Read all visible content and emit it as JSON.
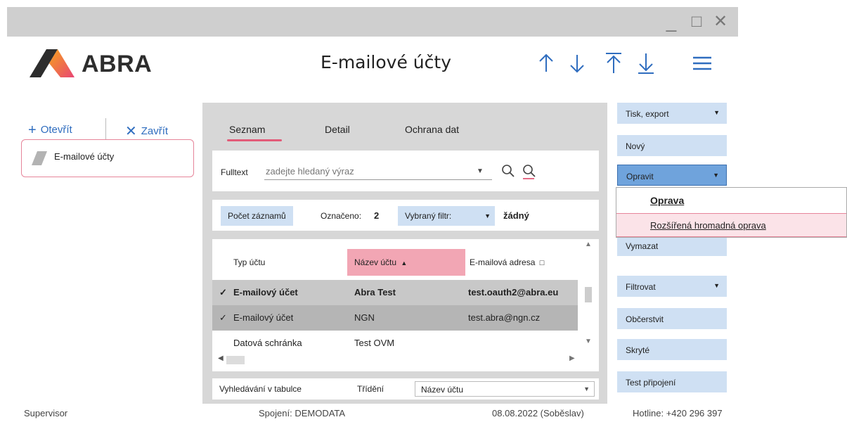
{
  "window": {
    "controls": {
      "minimize": "_",
      "maximize": "□",
      "close": "✕"
    }
  },
  "header": {
    "logo_text": "ABRA",
    "title": "E-mailové účty",
    "nav_icons": [
      "arrow-up-icon",
      "arrow-down-icon",
      "arrow-to-top-icon",
      "arrow-to-bottom-icon",
      "hamburger-menu-icon"
    ]
  },
  "left_panel": {
    "open_label": "Otevřít",
    "close_label": "Zavřít",
    "doc_item_label": "E-mailové účty"
  },
  "tabs": [
    {
      "label": "Seznam",
      "active": true
    },
    {
      "label": "Detail",
      "active": false
    },
    {
      "label": "Ochrana dat",
      "active": false
    }
  ],
  "fulltext": {
    "label": "Fulltext",
    "placeholder": "zadejte hledaný výraz"
  },
  "stats": {
    "count_button": "Počet záznamů",
    "marked_label": "Označeno:",
    "marked_value": "2",
    "filter_label": "Vybraný filtr:",
    "filter_value": "žádný"
  },
  "table": {
    "columns": [
      "Typ účtu",
      "Název účtu",
      "E-mailová adresa"
    ],
    "sort_indicator": "▲",
    "rows": [
      {
        "check": "✓",
        "type": "E-mailový účet",
        "name": "Abra Test",
        "email": "test.oauth2@abra.eu"
      },
      {
        "check": "✓",
        "type": "E-mailový účet",
        "name": "NGN",
        "email": "test.abra@ngn.cz"
      },
      {
        "check": "",
        "type": "Datová schránka",
        "name": "Test OVM",
        "email": ""
      }
    ]
  },
  "search_bar": {
    "label": "Vyhledávání v tabulce",
    "sort_label": "Třídění",
    "sort_value": "Název účtu"
  },
  "actions": {
    "print_export": "Tisk, export",
    "new": "Nový",
    "edit": "Opravit",
    "delete": "Vymazat",
    "filter": "Filtrovat",
    "refresh": "Občerstvit",
    "hidden": "Skryté",
    "test_connection": "Test připojení"
  },
  "edit_menu": {
    "items": [
      {
        "label": "Oprava",
        "accel": "O"
      },
      {
        "label": "Rozšířená hromadná oprava",
        "accel": "R"
      }
    ]
  },
  "status": {
    "user": "Supervisor",
    "connection": "Spojení: DEMODATA",
    "date": "08.08.2022 (Soběslav)",
    "hotline": "Hotline: +420 296 397"
  },
  "colors": {
    "accent_pink": "#e25b78",
    "button_blue": "#cfe0f3",
    "button_active_blue": "#6fa3dc",
    "link_blue": "#2f6dbf",
    "selected_row": "#c8c8c8",
    "sorted_header": "#f2a6b4"
  }
}
